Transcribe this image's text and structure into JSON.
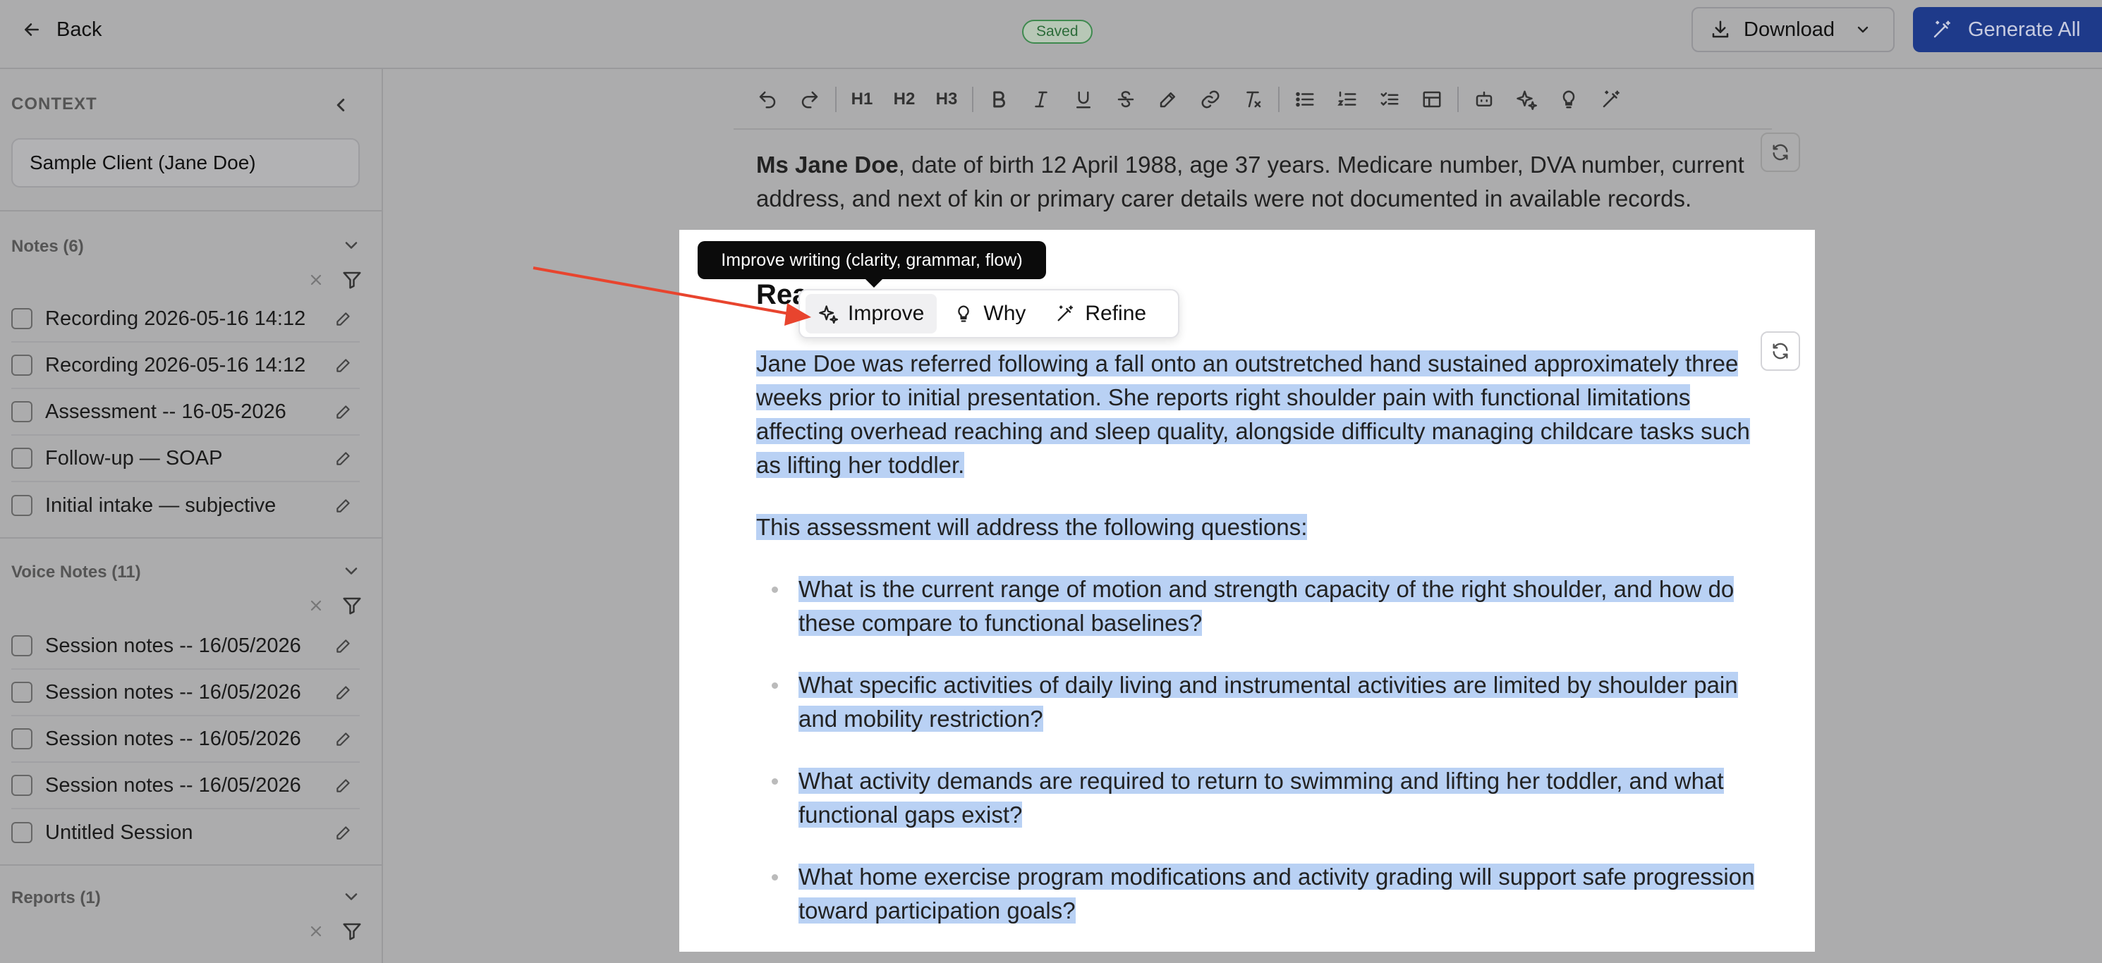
{
  "header": {
    "back_label": "Back",
    "saved_badge": "Saved",
    "download_label": "Download",
    "generate_all_label": "Generate All"
  },
  "sidebar": {
    "context_label": "CONTEXT",
    "client_value": "Sample Client (Jane Doe)",
    "notes": {
      "title": "Notes (6)",
      "items": [
        {
          "label": "Recording 2026-05-16 14:12"
        },
        {
          "label": "Recording 2026-05-16 14:12"
        },
        {
          "label": "Assessment -- 16-05-2026"
        },
        {
          "label": "Follow-up — SOAP"
        },
        {
          "label": "Initial intake — subjective"
        }
      ]
    },
    "voice_notes": {
      "title": "Voice Notes (11)",
      "items": [
        {
          "label": "Session notes -- 16/05/2026"
        },
        {
          "label": "Session notes -- 16/05/2026"
        },
        {
          "label": "Session notes -- 16/05/2026"
        },
        {
          "label": "Session notes -- 16/05/2026"
        },
        {
          "label": "Untitled Session"
        }
      ]
    },
    "reports": {
      "title": "Reports (1)"
    }
  },
  "toolbar": {
    "h1": "H1",
    "h2": "H2",
    "h3": "H3"
  },
  "document": {
    "intro_bold": "Ms Jane Doe",
    "intro_rest": ", date of birth 12 April 1988, age 37 years. Medicare number, DVA number, current address, and next of kin or primary carer details were not documented in available records.",
    "heading_partial": "Rea",
    "paragraph_1": "Jane Doe was referred following a fall onto an outstretched hand sustained approximately three weeks prior to initial presentation. She reports right shoulder pain with functional limitations affecting overhead reaching and sleep quality, alongside difficulty managing childcare tasks such as lifting her toddler.",
    "paragraph_2": "This assessment will address the following questions:",
    "questions": [
      "What is the current range of motion and strength capacity of the right shoulder, and how do these compare to functional baselines?",
      "What specific activities of daily living and instrumental activities are limited by shoulder pain and mobility restriction?",
      "What activity demands are required to return to swimming and lifting her toddler, and what functional gaps exist?",
      "What home exercise program modifications and activity grading will support safe progression toward participation goals?"
    ]
  },
  "ai_popup": {
    "tooltip": "Improve writing (clarity, grammar, flow)",
    "improve_label": "Improve",
    "why_label": "Why",
    "refine_label": "Refine"
  },
  "colors": {
    "accent": "#1e3a8a",
    "selection": "#b9d1f4",
    "annotation_arrow": "#e8442e",
    "saved_green": "#2c6b39"
  }
}
